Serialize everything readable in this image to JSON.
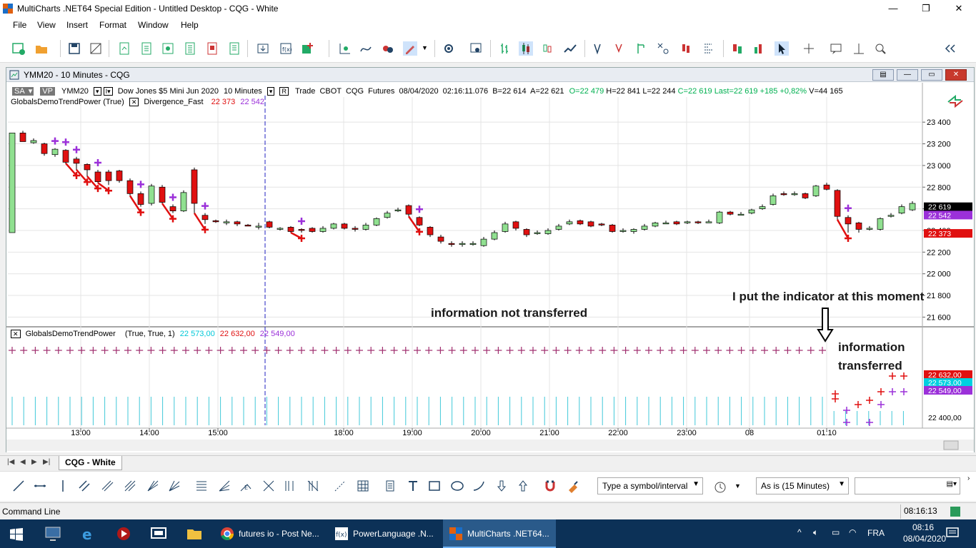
{
  "app": {
    "title": "MultiCharts .NET64 Special Edition - Untitled Desktop - CQG - White",
    "window_controls": [
      "—",
      "❐",
      "✕"
    ]
  },
  "menu": [
    "File",
    "View",
    "Insert",
    "Format",
    "Window",
    "Help"
  ],
  "chart_window": {
    "title": "YMM20 - 10 Minutes - CQG",
    "status_line": {
      "mode": "SA",
      "vp": "VP",
      "symbol": "YMM20",
      "description": "Dow Jones $5 Mini Jun 2020",
      "interval": "10 Minutes",
      "r_badge": "R",
      "exchange_info": "Trade  CBOT  CQG  Futures  08/04/2020  02:16:11.076  B=22 614  A=22 621",
      "open": "O=22 479",
      "high": "H=22 841",
      "low": "L=22 244",
      "close": "C=22 619",
      "last": "Last=22 619",
      "change": "+185",
      "change_pct": "+0,82%",
      "volume": "V=44 165"
    },
    "indicator_line": {
      "name": "GlobalsDemoTrendPower (True)",
      "study2": "Divergence_Fast",
      "val1": "22 373",
      "val2": "22 542"
    },
    "subpane_line": {
      "name": "GlobalsDemoTrendPower",
      "params": "(True,  True,  1)",
      "v1": "22 573,00",
      "v2": "22 632,00",
      "v3": "22 549,00"
    },
    "price_axis": [
      "23 400",
      "23 200",
      "23 000",
      "22 800",
      "22 600",
      "22 400",
      "22 200",
      "22 000",
      "21 800",
      "21 600"
    ],
    "price_tags": [
      {
        "label": "22 619",
        "color": "#000000"
      },
      {
        "label": "22 542",
        "color": "#9b30d9"
      },
      {
        "label": "22 373",
        "color": "#e01010"
      }
    ],
    "sub_tags": [
      {
        "label": "22 632,00",
        "color": "#e01010"
      },
      {
        "label": "22 573,00",
        "color": "#00d0e0"
      },
      {
        "label": "22 549,00",
        "color": "#9b30d9"
      },
      {
        "label": "22 400,00",
        "color": "#ffffff"
      }
    ],
    "time_axis": [
      "13:00",
      "14:00",
      "15:00",
      "18:00",
      "19:00",
      "20:00",
      "21:00",
      "22:00",
      "23:00",
      "08",
      "01:10"
    ],
    "annotations": {
      "not_transferred": "information not transferred",
      "moment": "I put the indicator at this moment",
      "transferred_1": "information",
      "transferred_2": "transferred"
    }
  },
  "tabs": {
    "active": "CQG - White"
  },
  "drawing_toolbar": {
    "symbol_placeholder": "Type a symbol/interval",
    "resolution": "As is (15 Minutes)"
  },
  "command_line": {
    "label": "Command Line",
    "time": "08:16:13"
  },
  "taskbar": {
    "items": [
      "futures io - Post Ne...",
      "PowerLanguage .N...",
      "MultiCharts .NET64..."
    ],
    "lang": "FRA",
    "clock_time": "08:16",
    "clock_date": "08/04/2020"
  },
  "colors": {
    "up": "#90e090",
    "down": "#e01010",
    "marker_purple": "#9b30d9",
    "marker_red": "#e01010",
    "histogram": "#40c8d8",
    "sub_plus": "#a03070",
    "annotation": "#1a1a1a"
  },
  "candles": [
    [
      22380,
      23300,
      23260,
      23240
    ],
    [
      23300,
      23220,
      23320,
      23220
    ],
    [
      23210,
      23230,
      23250,
      23200
    ],
    [
      23200,
      23110,
      23210,
      23090
    ],
    [
      23100,
      23150,
      23160,
      23080
    ],
    [
      23140,
      23030,
      23150,
      23020
    ],
    [
      23060,
      23020,
      23080,
      22960
    ],
    [
      23010,
      22960,
      23020,
      22900
    ],
    [
      22940,
      22850,
      22960,
      22840
    ],
    [
      22940,
      22860,
      22960,
      22820
    ],
    [
      22950,
      22860,
      22960,
      22840
    ],
    [
      22860,
      22740,
      22880,
      22720
    ],
    [
      22740,
      22640,
      22760,
      22620
    ],
    [
      22650,
      22810,
      22830,
      22630
    ],
    [
      22800,
      22660,
      22820,
      22650
    ],
    [
      22620,
      22580,
      22640,
      22560
    ],
    [
      22580,
      22750,
      22770,
      22570
    ],
    [
      22960,
      22650,
      22980,
      22560
    ],
    [
      22540,
      22500,
      22560,
      22460
    ],
    [
      22490,
      22480,
      22500,
      22470
    ],
    [
      22470,
      22480,
      22500,
      22450
    ],
    [
      22480,
      22460,
      22490,
      22440
    ],
    [
      22450,
      22440,
      22460,
      22440
    ],
    [
      22440,
      22440,
      22470,
      22410
    ],
    [
      22480,
      22430,
      22490,
      22420
    ],
    [
      22420,
      22420,
      22430,
      22400
    ],
    [
      22430,
      22390,
      22440,
      22380
    ],
    [
      22410,
      22400,
      22420,
      22380
    ],
    [
      22420,
      22390,
      22430,
      22380
    ],
    [
      22390,
      22420,
      22440,
      22380
    ],
    [
      22420,
      22460,
      22470,
      22410
    ],
    [
      22460,
      22420,
      22470,
      22410
    ],
    [
      22420,
      22410,
      22440,
      22390
    ],
    [
      22410,
      22450,
      22470,
      22400
    ],
    [
      22450,
      22510,
      22520,
      22440
    ],
    [
      22520,
      22560,
      22580,
      22510
    ],
    [
      22580,
      22590,
      22610,
      22570
    ],
    [
      22630,
      22550,
      22640,
      22530
    ],
    [
      22520,
      22450,
      22530,
      22440
    ],
    [
      22430,
      22360,
      22440,
      22340
    ],
    [
      22340,
      22300,
      22360,
      22280
    ],
    [
      22280,
      22270,
      22300,
      22250
    ],
    [
      22270,
      22280,
      22300,
      22250
    ],
    [
      22280,
      22280,
      22300,
      22260
    ],
    [
      22260,
      22320,
      22340,
      22250
    ],
    [
      22320,
      22380,
      22400,
      22310
    ],
    [
      22390,
      22460,
      22480,
      22380
    ],
    [
      22480,
      22420,
      22490,
      22400
    ],
    [
      22410,
      22360,
      22420,
      22340
    ],
    [
      22380,
      22380,
      22400,
      22360
    ],
    [
      22370,
      22400,
      22420,
      22360
    ],
    [
      22410,
      22440,
      22460,
      22400
    ],
    [
      22460,
      22480,
      22500,
      22450
    ],
    [
      22490,
      22460,
      22500,
      22450
    ],
    [
      22480,
      22440,
      22490,
      22430
    ],
    [
      22460,
      22450,
      22470,
      22440
    ],
    [
      22450,
      22390,
      22460,
      22380
    ],
    [
      22390,
      22400,
      22420,
      22380
    ],
    [
      22390,
      22410,
      22420,
      22370
    ],
    [
      22410,
      22440,
      22460,
      22400
    ],
    [
      22440,
      22470,
      22480,
      22430
    ],
    [
      22470,
      22470,
      22490,
      22460
    ],
    [
      22480,
      22460,
      22490,
      22450
    ],
    [
      22470,
      22480,
      22490,
      22460
    ],
    [
      22480,
      22470,
      22490,
      22460
    ],
    [
      22480,
      22480,
      22500,
      22470
    ],
    [
      22470,
      22570,
      22580,
      22460
    ],
    [
      22570,
      22550,
      22580,
      22540
    ],
    [
      22550,
      22550,
      22570,
      22540
    ],
    [
      22560,
      22590,
      22600,
      22550
    ],
    [
      22600,
      22620,
      22640,
      22590
    ],
    [
      22640,
      22720,
      22740,
      22630
    ],
    [
      22740,
      22730,
      22760,
      22720
    ],
    [
      22730,
      22740,
      22760,
      22720
    ],
    [
      22740,
      22700,
      22750,
      22690
    ],
    [
      22720,
      22810,
      22820,
      22710
    ],
    [
      22820,
      22780,
      22840,
      22770
    ],
    [
      22770,
      22530,
      22780,
      22500
    ],
    [
      22520,
      22460,
      22540,
      22380
    ],
    [
      22470,
      22410,
      22480,
      22380
    ],
    [
      22420,
      22420,
      22440,
      22400
    ],
    [
      22410,
      22510,
      22520,
      22400
    ],
    [
      22530,
      22540,
      22560,
      22520
    ],
    [
      22560,
      22620,
      22640,
      22550
    ],
    [
      22590,
      22650,
      22670,
      22580
    ]
  ],
  "purple_marks": [
    4,
    5,
    6,
    8,
    12,
    15,
    18,
    27,
    38,
    78
  ],
  "red_marks": [
    6,
    7,
    8,
    9,
    12,
    15,
    18,
    27,
    38,
    78
  ]
}
